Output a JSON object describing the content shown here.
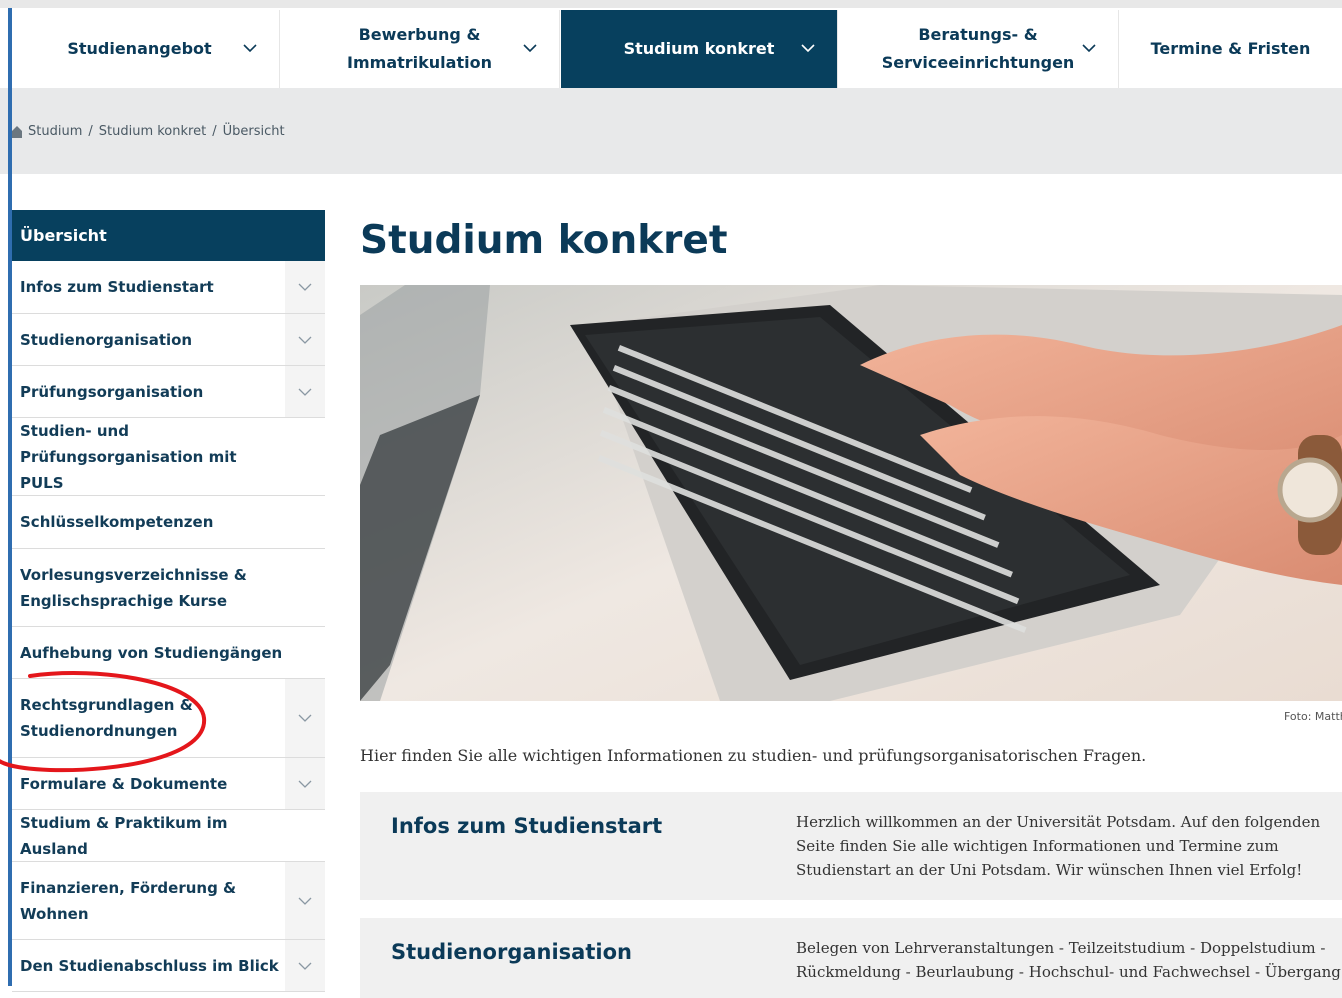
{
  "topnav": {
    "items": [
      {
        "label": "Studienangebot"
      },
      {
        "label": "Bewerbung & Immatrikulation"
      },
      {
        "label": "Studium konkret"
      },
      {
        "label": "Beratungs- & Serviceeinrichtungen"
      },
      {
        "label": "Termine & Fristen"
      }
    ]
  },
  "breadcrumb": {
    "items": [
      "Studium",
      "Studium konkret",
      "Übersicht"
    ],
    "separator": "/"
  },
  "sidebar": {
    "header": "Übersicht",
    "items": [
      {
        "label": "Infos zum Studienstart"
      },
      {
        "label": "Studienorganisation"
      },
      {
        "label": "Prüfungsorganisation"
      },
      {
        "label": "Studien- und Prüfungsorganisation mit PULS"
      },
      {
        "label": "Schlüsselkompetenzen"
      },
      {
        "label": "Vorlesungsverzeichnisse & Englischsprachige Kurse"
      },
      {
        "label": "Aufhebung von Studiengängen"
      },
      {
        "label": "Rechtsgrundlagen & Studienordnungen"
      },
      {
        "label": "Formulare & Dokumente"
      },
      {
        "label": "Studium & Praktikum im Ausland"
      },
      {
        "label": "Finanzieren, Förderung & Wohnen"
      },
      {
        "label": "Den Studienabschluss im Blick"
      }
    ]
  },
  "main": {
    "title": "Studium konkret",
    "photo_credit": "Foto: Matth",
    "intro": "Hier finden Sie alle wichtigen Informationen zu studien- und prüfungsorganisatorischen Fragen.",
    "cards": [
      {
        "title": "Infos zum Studienstart",
        "text": "Herzlich willkommen an der Universität Potsdam. Auf den folgenden Seite finden Sie alle wichtigen Informationen und Termine zum Studienstart an der Uni Potsdam. Wir wünschen Ihnen viel Erfolg!"
      },
      {
        "title": "Studienorganisation",
        "text": "Belegen von Lehrveranstaltungen - Teilzeitstudium - Doppelstudium - Rückmeldung - Beurlaubung - Hochschul- und Fachwechsel - Übergang"
      }
    ]
  },
  "colors": {
    "brand_dark": "#07405e",
    "annotation": "#e4161b",
    "accent_blue": "#2f6db0"
  },
  "icons": [
    "home-icon",
    "chevron-down-icon",
    "keyboard-photo"
  ]
}
